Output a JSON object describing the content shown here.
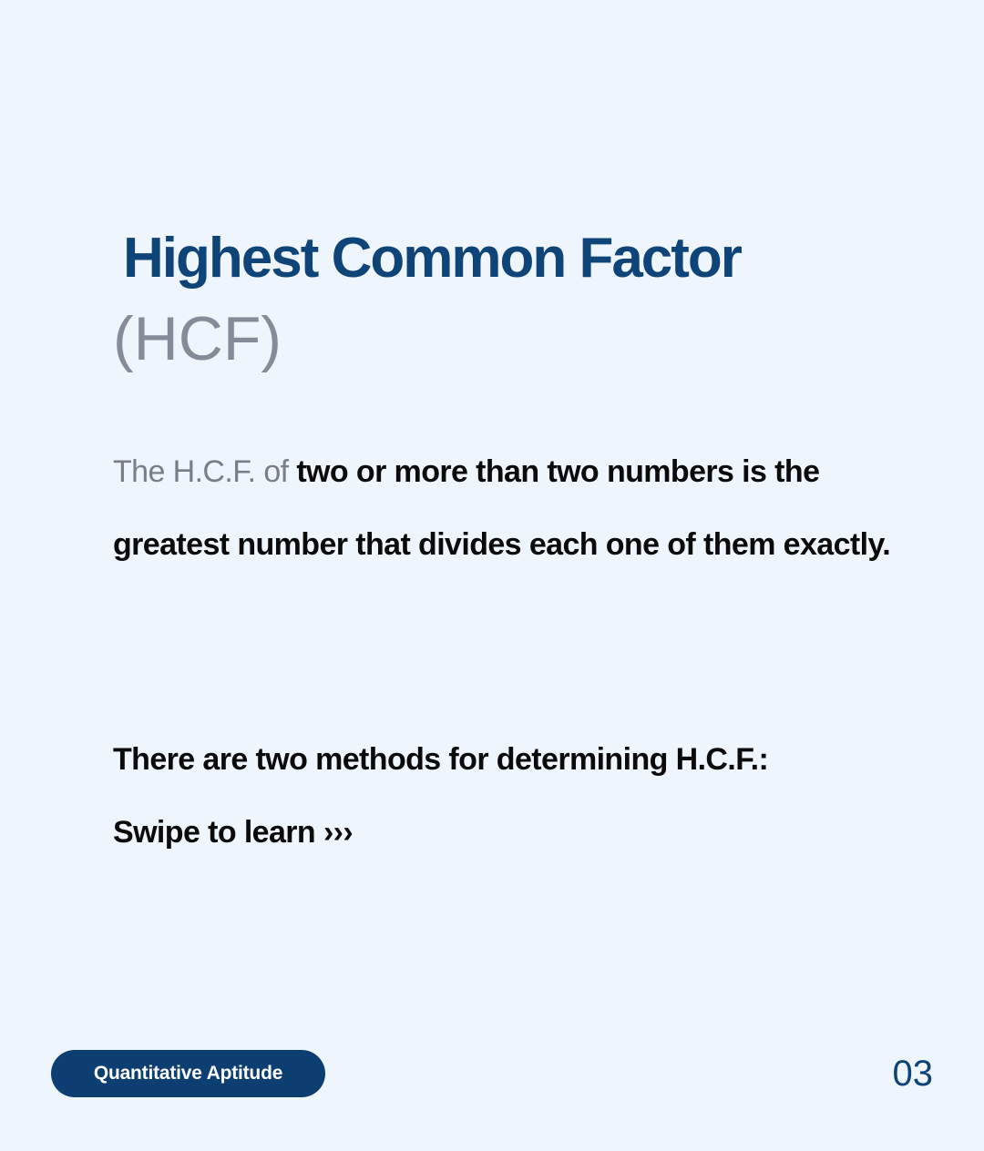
{
  "title": "Highest Common Factor",
  "subtitle": "(HCF)",
  "definition": {
    "lead": "The H.C.F. of ",
    "emphasis": "two or more than two numbers is the greatest number that divides each one of them exactly."
  },
  "methods": {
    "line1": "There are two methods for determining H.C.F.:",
    "line2": "Swipe to learn ›››"
  },
  "footer": {
    "badge": "Quantitative Aptitude",
    "page_number": "03"
  },
  "colors": {
    "background": "#eff5fd",
    "accent": "#0e4477",
    "badge": "#0c3e71",
    "muted": "#868b9a",
    "text": "#0b0b0b"
  }
}
